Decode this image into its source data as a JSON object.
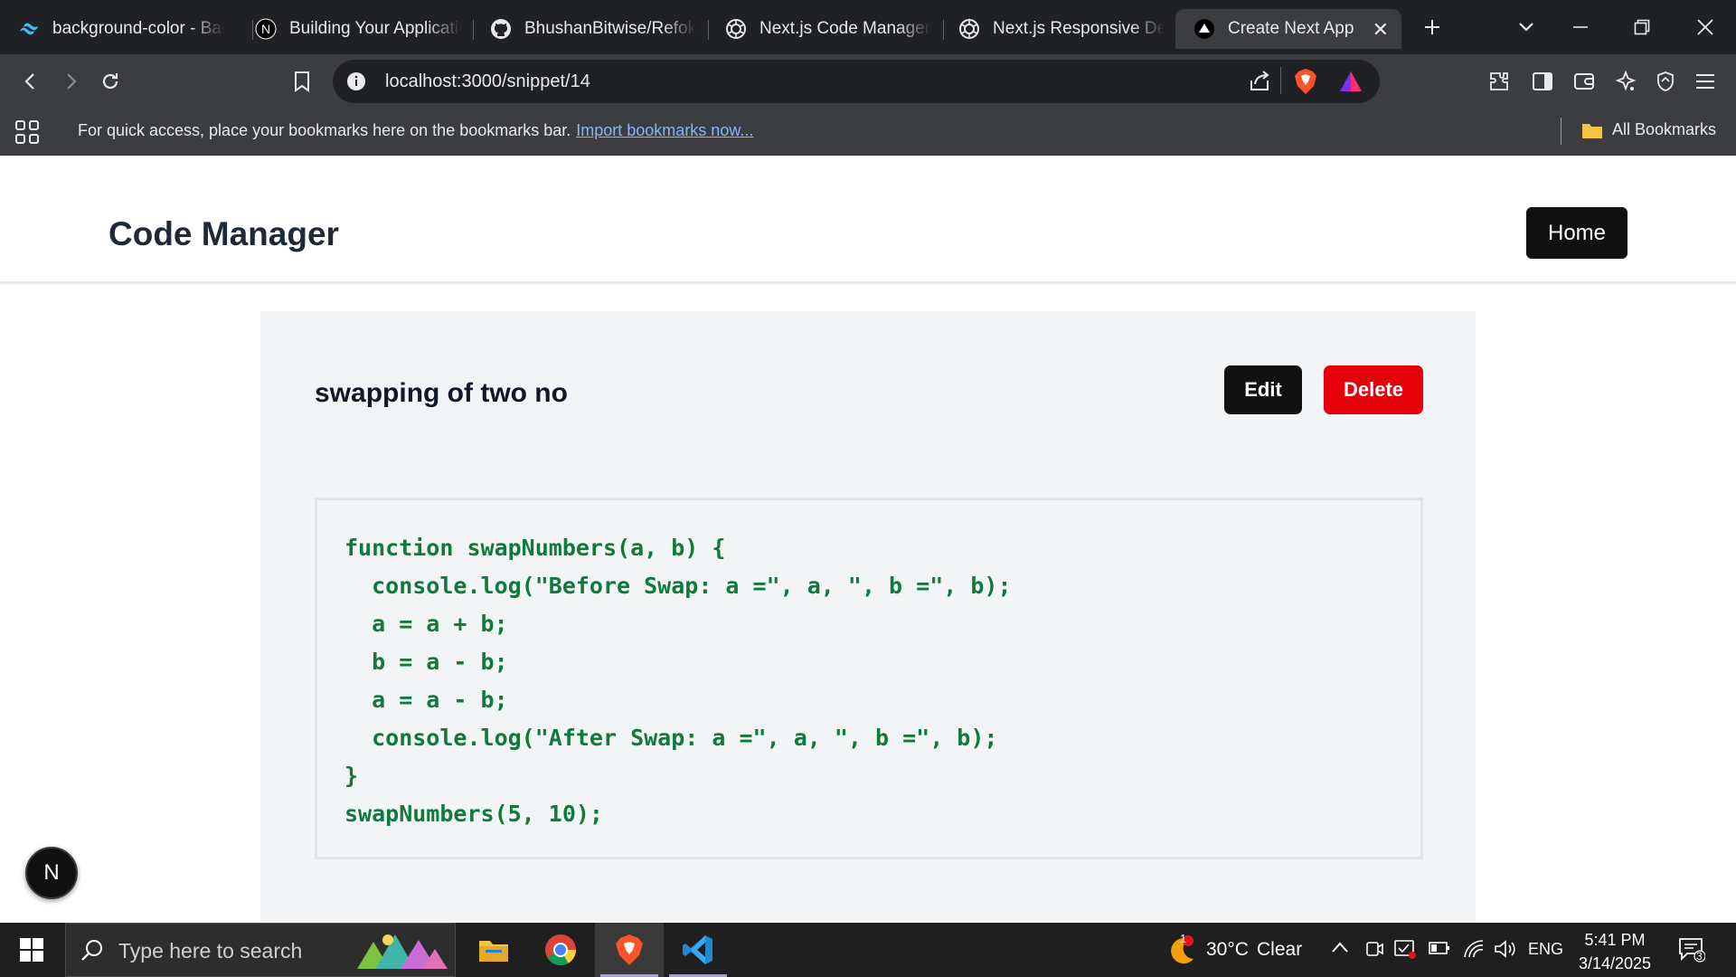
{
  "browser": {
    "tabs": [
      {
        "title": "background-color - Background Color",
        "icon": "tailwind-icon"
      },
      {
        "title": "Building Your Application",
        "icon": "nextjs-icon"
      },
      {
        "title": "BhushanBitwise/Refokus",
        "icon": "github-icon"
      },
      {
        "title": "Next.js Code Manager",
        "icon": "openai-icon"
      },
      {
        "title": "Next.js Responsive Design",
        "icon": "openai-icon"
      },
      {
        "title": "Create Next App",
        "icon": "vercel-triangle-icon"
      }
    ],
    "url": "localhost:3000/snippet/14",
    "bookmarks_message": "For quick access, place your bookmarks here on the bookmarks bar.",
    "bookmarks_link": "Import bookmarks now...",
    "all_bookmarks": "All Bookmarks"
  },
  "page": {
    "brand": "Code Manager",
    "home_label": "Home",
    "snippet": {
      "title": "swapping of two no",
      "edit_label": "Edit",
      "delete_label": "Delete",
      "code": "function swapNumbers(a, b) {\n  console.log(\"Before Swap: a =\", a, \", b =\", b);\n  a = a + b;\n  b = a - b;\n  a = a - b;\n  console.log(\"After Swap: a =\", a, \", b =\", b);\n}\nswapNumbers(5, 10);"
    },
    "dev_badge": "N"
  },
  "taskbar": {
    "search_placeholder": "Type here to search",
    "weather_temp": "30°C",
    "weather_desc": "Clear",
    "weather_badge": "1",
    "language": "ENG",
    "time": "5:41 PM",
    "date": "3/14/2025",
    "notification_count": "3"
  },
  "colors": {
    "code_text": "#0f7a3c",
    "delete_button": "#e5000b",
    "dark_button": "#111111"
  }
}
